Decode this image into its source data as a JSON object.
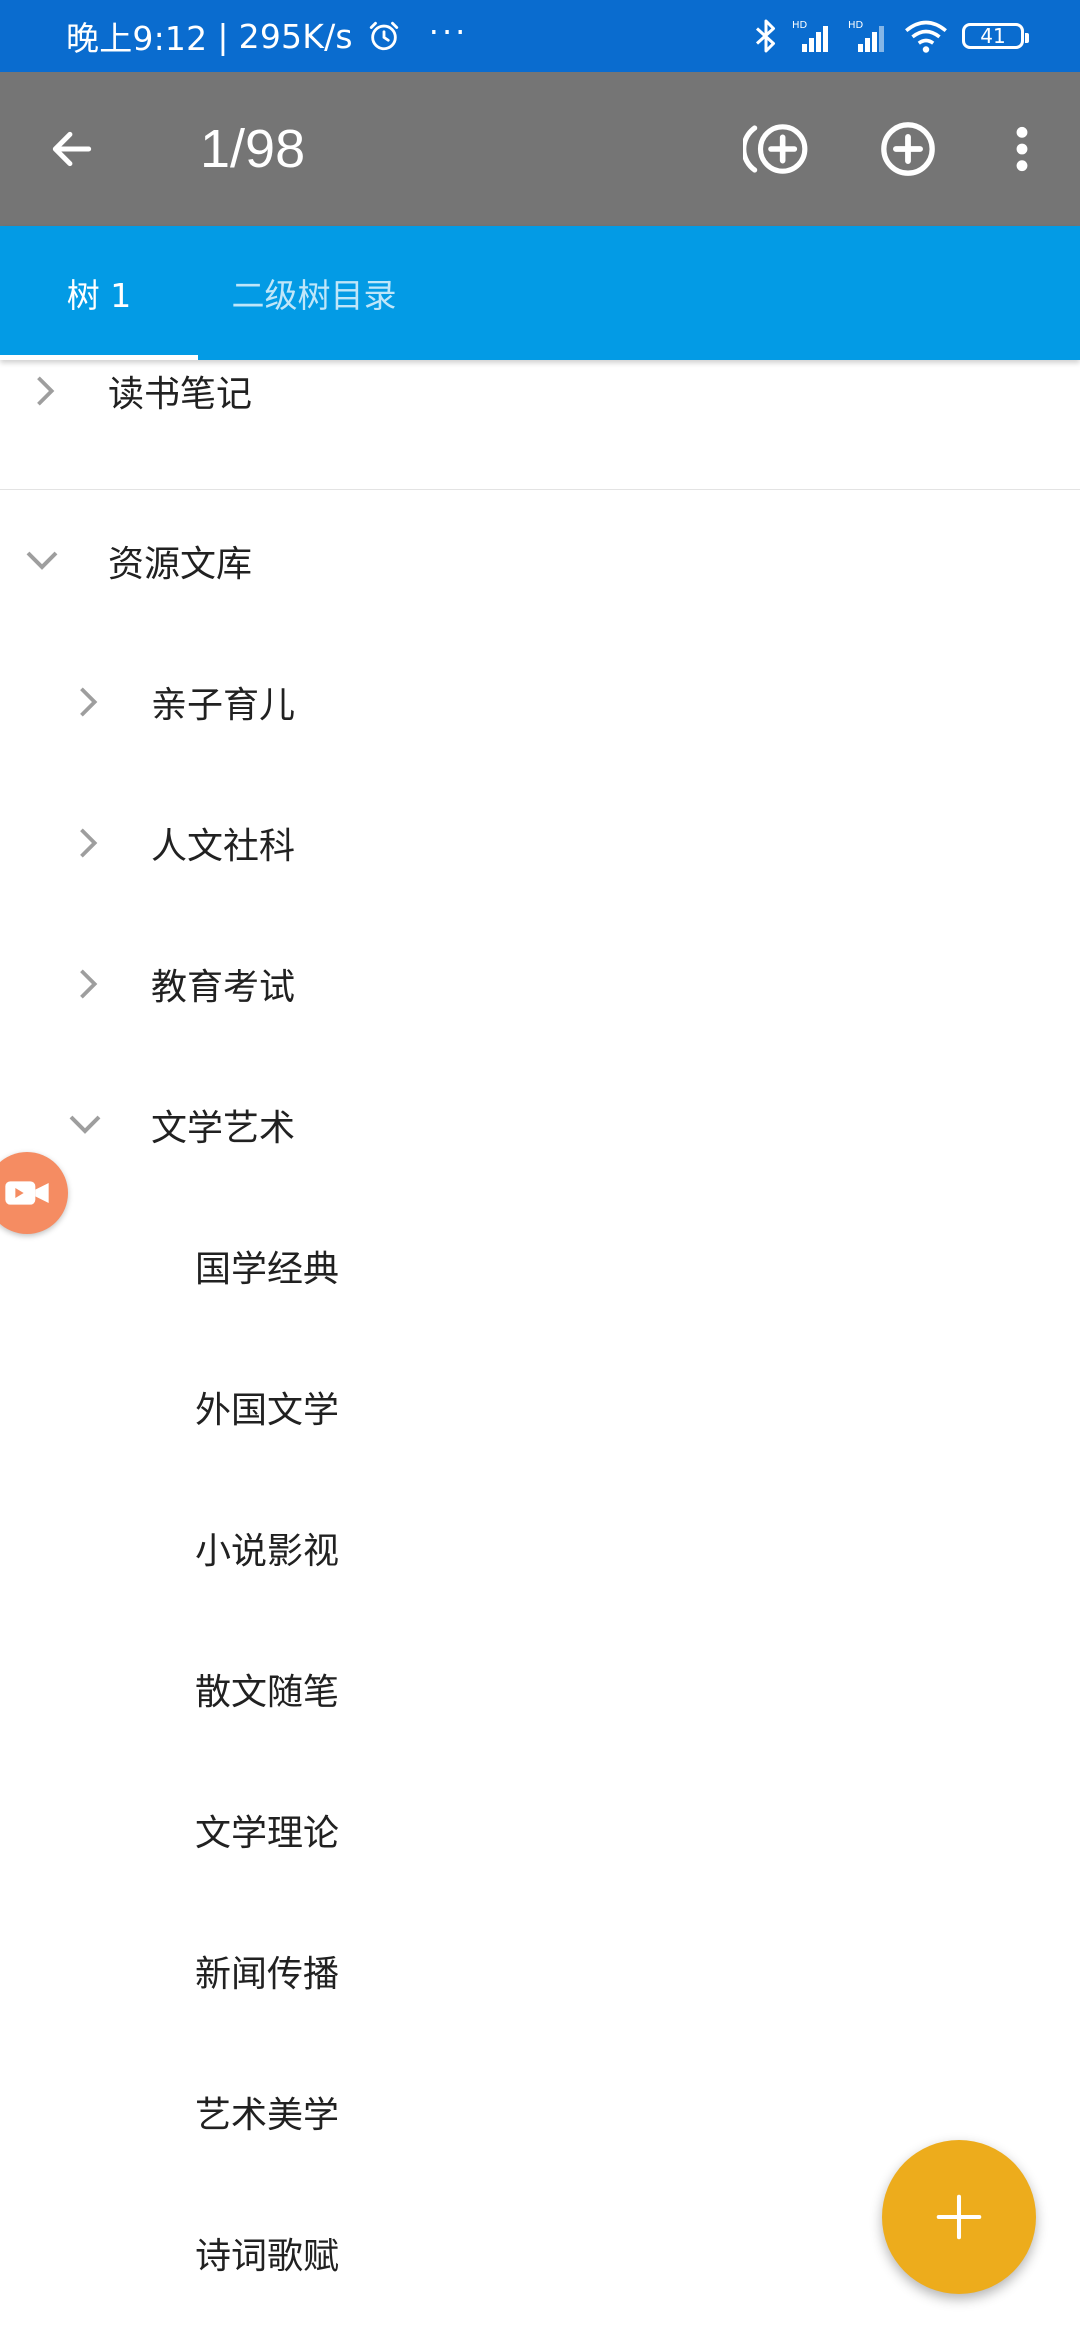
{
  "status_bar": {
    "time": "晚上9:12",
    "separator": "|",
    "speed": "295K/s",
    "more": "···",
    "battery": "41"
  },
  "app_bar": {
    "title": "1/98"
  },
  "tabs": [
    {
      "label": "树 1",
      "selected": true
    },
    {
      "label": "二级树目录",
      "selected": false
    }
  ],
  "tree": {
    "items": [
      {
        "label": "读书笔记",
        "expanded": false
      },
      {
        "label": "资源文库",
        "expanded": true
      },
      {
        "label": "亲子育儿",
        "expanded": false
      },
      {
        "label": "人文社科",
        "expanded": false
      },
      {
        "label": "教育考试",
        "expanded": false
      },
      {
        "label": "文学艺术",
        "expanded": true
      },
      {
        "label": "国学经典"
      },
      {
        "label": "外国文学"
      },
      {
        "label": "小说影视"
      },
      {
        "label": "散文随笔"
      },
      {
        "label": "文学理论"
      },
      {
        "label": "新闻传播"
      },
      {
        "label": "艺术美学"
      },
      {
        "label": "诗词歌赋"
      }
    ]
  },
  "colors": {
    "status_bar": "#0a6ccf",
    "app_bar": "#757575",
    "tab_bar": "#039be5",
    "fab": "#edac1c",
    "recorder": "#f58c62"
  },
  "icons": {
    "back": "arrow-left-icon",
    "add_sibling": "add-sibling-circle-icon",
    "add": "add-circle-icon",
    "more": "more-vert-icon",
    "collapsed": "chevron-right-icon",
    "expanded": "chevron-down-icon",
    "recorder": "video-camera-icon",
    "fab": "plus-icon"
  }
}
